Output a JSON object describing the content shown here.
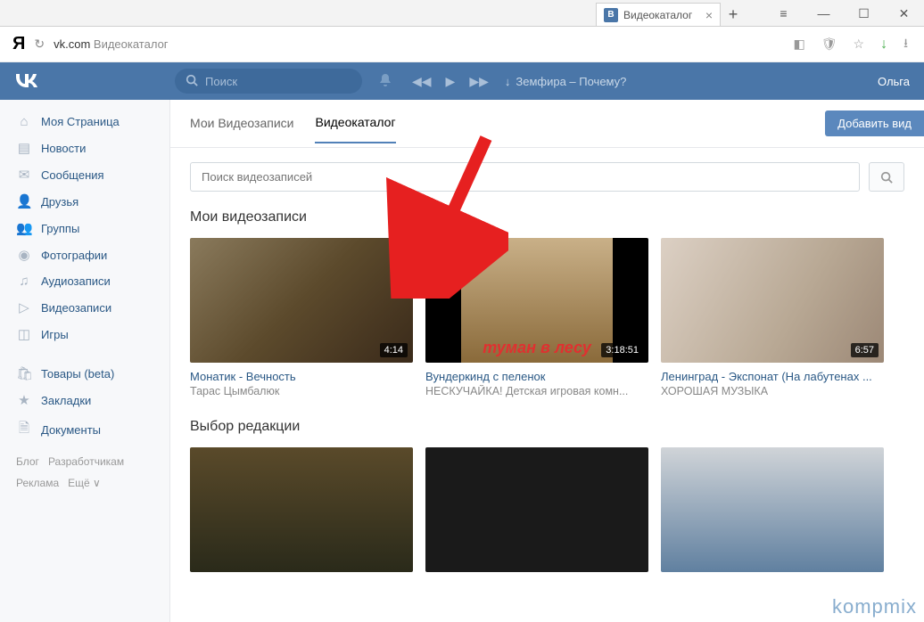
{
  "browser": {
    "tab_title": "Видеокаталог",
    "tab_favicon": "В",
    "url_domain": "vk.com",
    "url_path": "Видеокаталог"
  },
  "vk_header": {
    "search_placeholder": "Поиск",
    "now_playing": "Земфира – Почему?",
    "user": "Ольга"
  },
  "sidebar": {
    "items": [
      {
        "icon": "home",
        "label": "Моя Страница"
      },
      {
        "icon": "news",
        "label": "Новости"
      },
      {
        "icon": "msg",
        "label": "Сообщения"
      },
      {
        "icon": "friends",
        "label": "Друзья"
      },
      {
        "icon": "groups",
        "label": "Группы"
      },
      {
        "icon": "photo",
        "label": "Фотографии"
      },
      {
        "icon": "music",
        "label": "Аудиозаписи"
      },
      {
        "icon": "video",
        "label": "Видеозаписи"
      },
      {
        "icon": "games",
        "label": "Игры"
      }
    ],
    "items2": [
      {
        "icon": "bag",
        "label": "Товары (beta)"
      },
      {
        "icon": "bookmark",
        "label": "Закладки"
      },
      {
        "icon": "doc",
        "label": "Документы"
      }
    ],
    "footer": [
      "Блог",
      "Разработчикам",
      "Реклама",
      "Ещё ∨"
    ]
  },
  "tabs": {
    "my_videos": "Мои Видеозаписи",
    "catalog": "Видеокаталог",
    "add_button": "Добавить вид"
  },
  "video_search_placeholder": "Поиск видеозаписей",
  "section_my": "Мои видеозаписи",
  "section_editor": "Выбор редакции",
  "videos": [
    {
      "title": "Монатик - Вечность",
      "author": "Тарас Цымбалюк",
      "duration": "4:14"
    },
    {
      "title": "Вундеркинд с пеленок",
      "author": "НЕСКУЧАЙКА! Детская игровая комн...",
      "duration": "3:18:51",
      "thumb_caption": "туман в лесу"
    },
    {
      "title": "Ленинград - Экспонат (На лабутенах ...",
      "author": "ХОРОШАЯ МУЗЫКА",
      "duration": "6:57"
    }
  ],
  "watermark": "kompmix"
}
